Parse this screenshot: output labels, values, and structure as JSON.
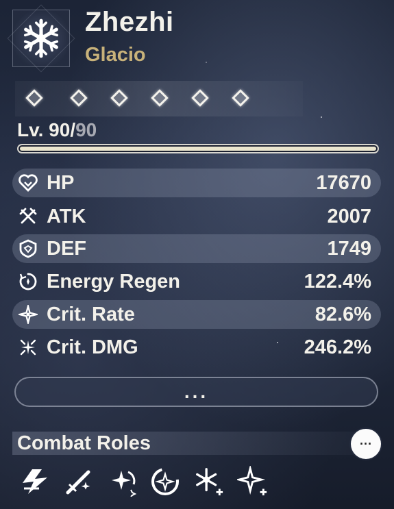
{
  "character": {
    "name": "Zhezhi",
    "element": "Glacio",
    "element_icon": "snowflake-icon"
  },
  "sequence": {
    "unlocked": 6,
    "total": 6
  },
  "level": {
    "prefix": "Lv. ",
    "current": "90",
    "separator": "/",
    "max": "90",
    "progress": 1.0
  },
  "stats": [
    {
      "icon": "hp-icon",
      "label": "HP",
      "value": "17670"
    },
    {
      "icon": "atk-icon",
      "label": "ATK",
      "value": "2007"
    },
    {
      "icon": "def-icon",
      "label": "DEF",
      "value": "1749"
    },
    {
      "icon": "energy-regen-icon",
      "label": "Energy Regen",
      "value": "122.4%"
    },
    {
      "icon": "crit-rate-icon",
      "label": "Crit. Rate",
      "value": "82.6%"
    },
    {
      "icon": "crit-dmg-icon",
      "label": "Crit. DMG",
      "value": "246.2%"
    }
  ],
  "more_button": {
    "label": "..."
  },
  "combat_roles": {
    "title": "Combat Roles",
    "more_label": "···",
    "icons": [
      "lightning-role-icon",
      "sword-role-icon",
      "sparkle-swirl-role-icon",
      "circle-sparkle-role-icon",
      "snowflake-plus-role-icon",
      "sparkle-plus-role-icon"
    ]
  },
  "colors": {
    "element": "#c8b27a",
    "text": "#f3f1ea",
    "muted": "#a8aab3"
  }
}
